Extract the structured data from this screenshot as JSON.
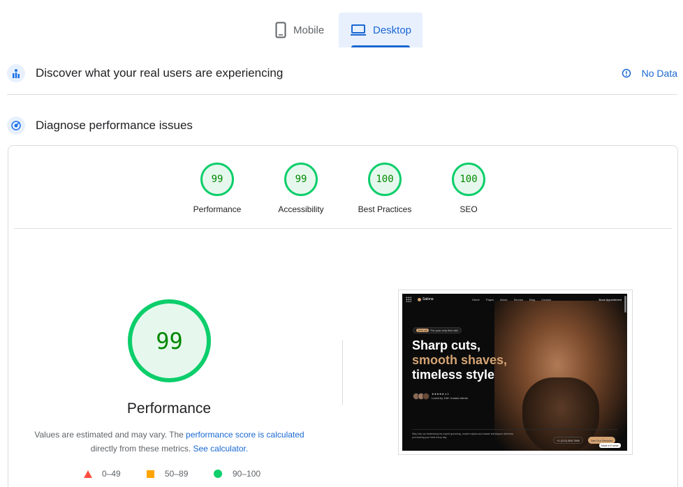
{
  "tabs": {
    "mobile": "Mobile",
    "desktop": "Desktop",
    "active": "Desktop"
  },
  "field_data": {
    "title": "Discover what your real users are experiencing",
    "status": "No Data"
  },
  "lab": {
    "title": "Diagnose performance issues",
    "categories": [
      {
        "score": "99",
        "label": "Performance"
      },
      {
        "score": "99",
        "label": "Accessibility"
      },
      {
        "score": "100",
        "label": "Best Practices"
      },
      {
        "score": "100",
        "label": "SEO"
      }
    ],
    "main_score": "99",
    "main_label": "Performance",
    "note_prefix": "Values are estimated and may vary. The ",
    "note_link": "performance score is calculated",
    "note_mid": " directly from these metrics. ",
    "note_link2": "See calculator.",
    "legend": [
      {
        "range": "0–49",
        "color": "#ff4e42"
      },
      {
        "range": "50–89",
        "color": "#ffa400"
      },
      {
        "range": "90–100",
        "color": "#0cce6b"
      }
    ]
  },
  "screenshot": {
    "logo": "Salona",
    "nav_links": "Home Pages About Service Blog Contact",
    "appointment": "Book Appointment",
    "badge_pill": "10% off",
    "badge_text": "For your very first visit",
    "headline_1": "Sharp cuts,",
    "headline_2": "smooth shaves,",
    "headline_3": "timeless style",
    "rating": "★★★★★ 4.9",
    "rating_sub": "Loved by 10k+ trusted clients",
    "footer_text": "Step into our barbershop for expert grooming, modern styles and classic techniques that keep you looking your best every day.",
    "phone": "+1 (212) 555-7890",
    "cta": "See Our Services",
    "made_in": "Made in Framer"
  },
  "colors": {
    "accent": "#1967d2",
    "pass": "#0cce6b",
    "pass_text": "#008800"
  }
}
